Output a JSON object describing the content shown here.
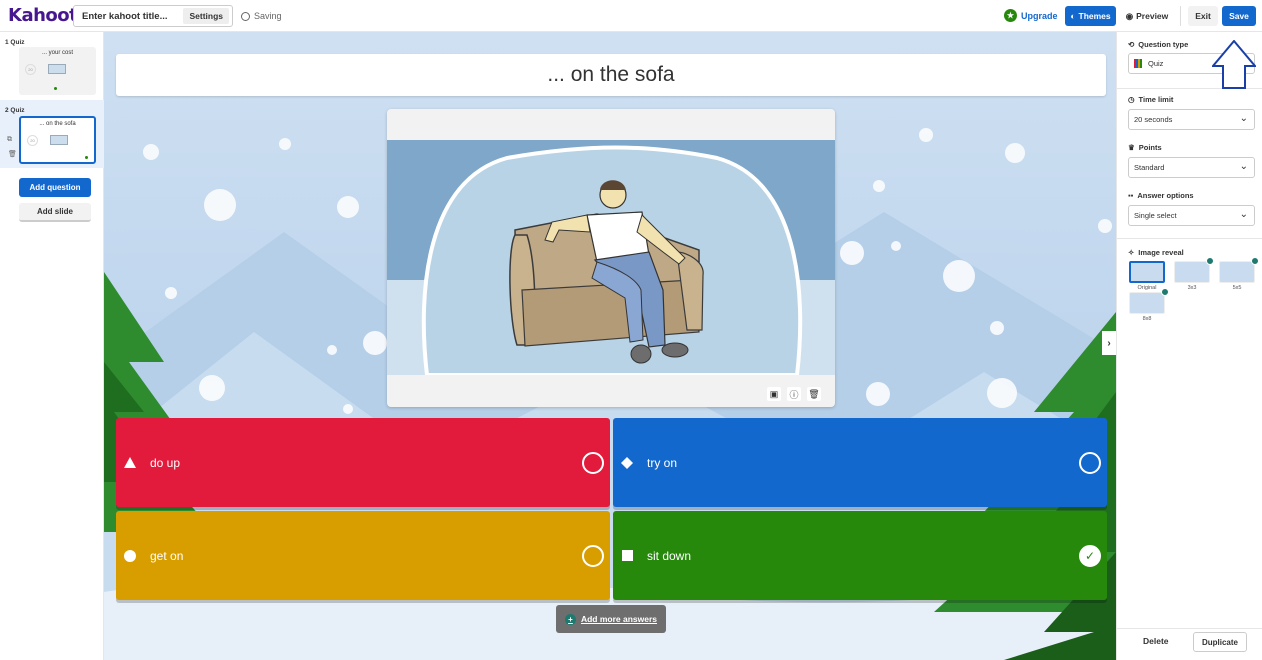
{
  "brand": {
    "logo": "Kahoot!"
  },
  "topbar": {
    "title_placeholder": "Enter kahoot title...",
    "settings_label": "Settings",
    "saving_label": "Saving",
    "upgrade_label": "Upgrade",
    "themes_label": "Themes",
    "preview_label": "Preview",
    "exit_label": "Exit",
    "save_label": "Save"
  },
  "sidebar": {
    "slides": [
      {
        "label": "1  Quiz",
        "title": "... your cost",
        "active": false
      },
      {
        "label": "2  Quiz",
        "title": "... on the sofa",
        "active": true
      }
    ],
    "add_question_label": "Add question",
    "add_slide_label": "Add slide"
  },
  "question": {
    "text": "... on the sofa"
  },
  "answers": [
    {
      "text": "do up",
      "shape": "triangle",
      "color": "#e21b3c",
      "correct": false
    },
    {
      "text": "try on",
      "shape": "diamond",
      "color": "#1368ce",
      "correct": false
    },
    {
      "text": "get on",
      "shape": "circle",
      "color": "#d89e00",
      "correct": false
    },
    {
      "text": "sit down",
      "shape": "square",
      "color": "#26890c",
      "correct": true
    }
  ],
  "add_more_answers_label": "Add more answers",
  "right_panel": {
    "question_type_label": "Question type",
    "question_type_value": "Quiz",
    "time_limit_label": "Time limit",
    "time_limit_value": "20 seconds",
    "points_label": "Points",
    "points_value": "Standard",
    "answer_options_label": "Answer options",
    "answer_options_value": "Single select",
    "image_reveal_label": "Image reveal",
    "image_reveal_options": [
      "Original",
      "3x3",
      "5x5",
      "8x8"
    ],
    "image_reveal_selected": "Original",
    "delete_label": "Delete",
    "duplicate_label": "Duplicate"
  },
  "colors": {
    "brand_purple": "#46178f",
    "primary_blue": "#1368ce",
    "red": "#e21b3c",
    "yellow": "#d89e00",
    "green": "#26890c",
    "overlay_arrow": "#1a3fa8"
  },
  "icons": [
    "saving-icon",
    "upgrade-star-icon",
    "themes-icon",
    "preview-eye-icon",
    "question-type-icon",
    "clock-icon",
    "trophy-icon",
    "answer-options-icon",
    "image-reveal-icon",
    "chevron-down-icon",
    "chevron-right-icon",
    "add-circle-icon",
    "replace-image-icon",
    "info-icon",
    "trash-icon",
    "check-icon"
  ]
}
